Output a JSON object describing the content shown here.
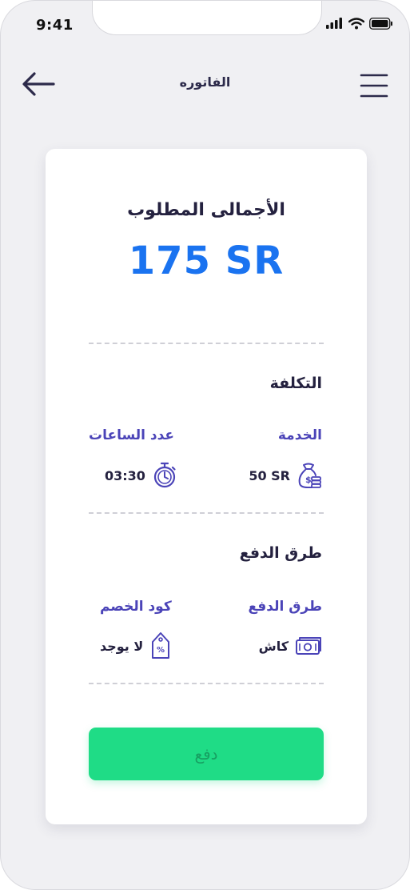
{
  "status_bar": {
    "time": "9:41"
  },
  "header": {
    "title": "الفاتوره"
  },
  "invoice": {
    "total_label": "الأجمالى المطلوب",
    "total_amount": "175 SR",
    "cost_section": {
      "title": "التكلفة",
      "service_label": "الخدمة",
      "service_value": "50 SR",
      "hours_label": "عدد الساعات",
      "hours_value": "03:30"
    },
    "payment_section": {
      "title": "طرق الدفع",
      "method_label": "طرق الدفع",
      "method_value": "كاش",
      "discount_label": "كود الخصم",
      "discount_value": "لا يوجد"
    },
    "pay_button_label": "دفع"
  },
  "icons": {
    "back": "arrow-left-icon",
    "menu": "hamburger-menu-icon",
    "service": "money-bag-icon",
    "hours": "stopwatch-icon",
    "method": "cash-icon",
    "discount": "discount-tag-icon"
  },
  "colors": {
    "accent_blue": "#1a73f0",
    "label_purple": "#4b44b8",
    "title_dark": "#24213f",
    "button_green": "#1fdc86",
    "button_text": "#17a062"
  }
}
